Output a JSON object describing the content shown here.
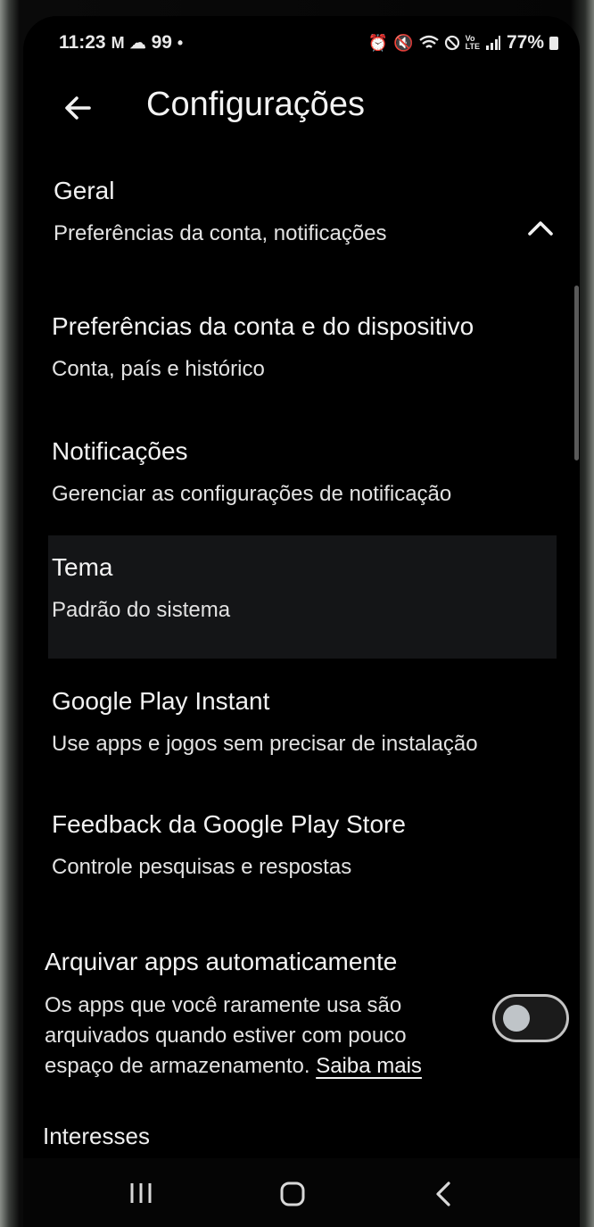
{
  "status": {
    "time": "11:23",
    "notifications": "99",
    "battery": "77%"
  },
  "header": {
    "title": "Configurações"
  },
  "section": {
    "title": "Geral",
    "subtitle": "Preferências da conta, notificações"
  },
  "items": [
    {
      "title": "Preferências da conta e do dispositivo",
      "subtitle": "Conta, país e histórico"
    },
    {
      "title": "Notificações",
      "subtitle": "Gerenciar as configurações de notificação"
    },
    {
      "title": "Tema",
      "subtitle": "Padrão do sistema"
    },
    {
      "title": "Google Play Instant",
      "subtitle": "Use apps e jogos sem precisar de instalação"
    },
    {
      "title": "Feedback da Google Play Store",
      "subtitle": "Controle pesquisas e respostas"
    }
  ],
  "archive": {
    "title": "Arquivar apps automaticamente",
    "description": "Os apps que você raramente usa são arquivados quando estiver com pouco espaço de armazenamento.",
    "link": "Saiba mais",
    "toggle_on": false
  },
  "next_section": {
    "title": "Interesses"
  },
  "colors": {
    "background": "#000000",
    "text": "#f1f1f1",
    "highlight": "#141517"
  }
}
